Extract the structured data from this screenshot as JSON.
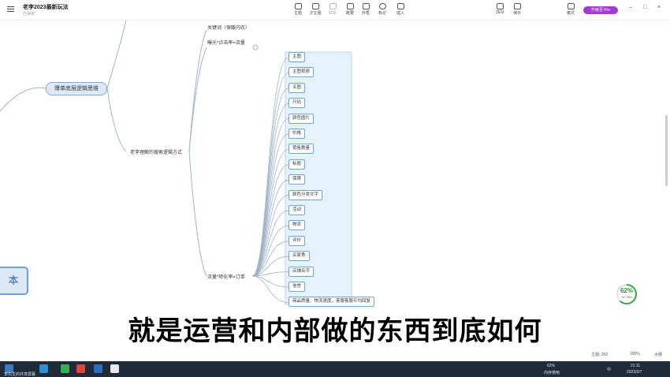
{
  "window": {
    "title": "老李2023最新玩法",
    "subtitle": "已保存",
    "pro_badge": "升级至 Pro",
    "min": "–",
    "max": "□",
    "close": "×"
  },
  "toolbar": {
    "items": [
      {
        "label": "主题"
      },
      {
        "label": "子主题"
      },
      {
        "label": "联系"
      },
      {
        "label": "概要"
      },
      {
        "label": "外框"
      },
      {
        "label": "标记"
      },
      {
        "label": "插入"
      }
    ],
    "right_items": [
      {
        "label": "ZEN"
      },
      {
        "label": "演示"
      },
      {
        "label": "格式"
      }
    ]
  },
  "mindmap": {
    "root_label": "爆单底层逻辑思维",
    "edge_label": "本",
    "branch_keyword": "关键词（保暖内衣）",
    "branch_click": "曝光*点击率=流量",
    "branch_search": "老李理解的搜索逻辑方式",
    "branch_order": "流量*转化率=订单",
    "topics": [
      "主图",
      "主图视频",
      "五图",
      "尺码",
      "颜色图片",
      "价格",
      "销售数量",
      "标题",
      "保障",
      "颜色分类文字",
      "活动",
      "物流",
      "评价",
      "买家秀",
      "店铺名字",
      "信誉",
      "商品质量、物流速度、客服客服平均回复"
    ]
  },
  "status": {
    "progress_value": 62,
    "progress_text": "62%",
    "progress_sub": "147.2K/s",
    "topic_count": "主题: 262",
    "zoom": "100%",
    "font_size": "大纲"
  },
  "caption": "就是运营和内部做的东西到底如何",
  "taskbar": {
    "user_line": "李先生的共享屏幕",
    "cpu": "62%",
    "cpu_label": "内存使用",
    "lang": "中",
    "time": "21:11",
    "date": "2023/2/7"
  }
}
